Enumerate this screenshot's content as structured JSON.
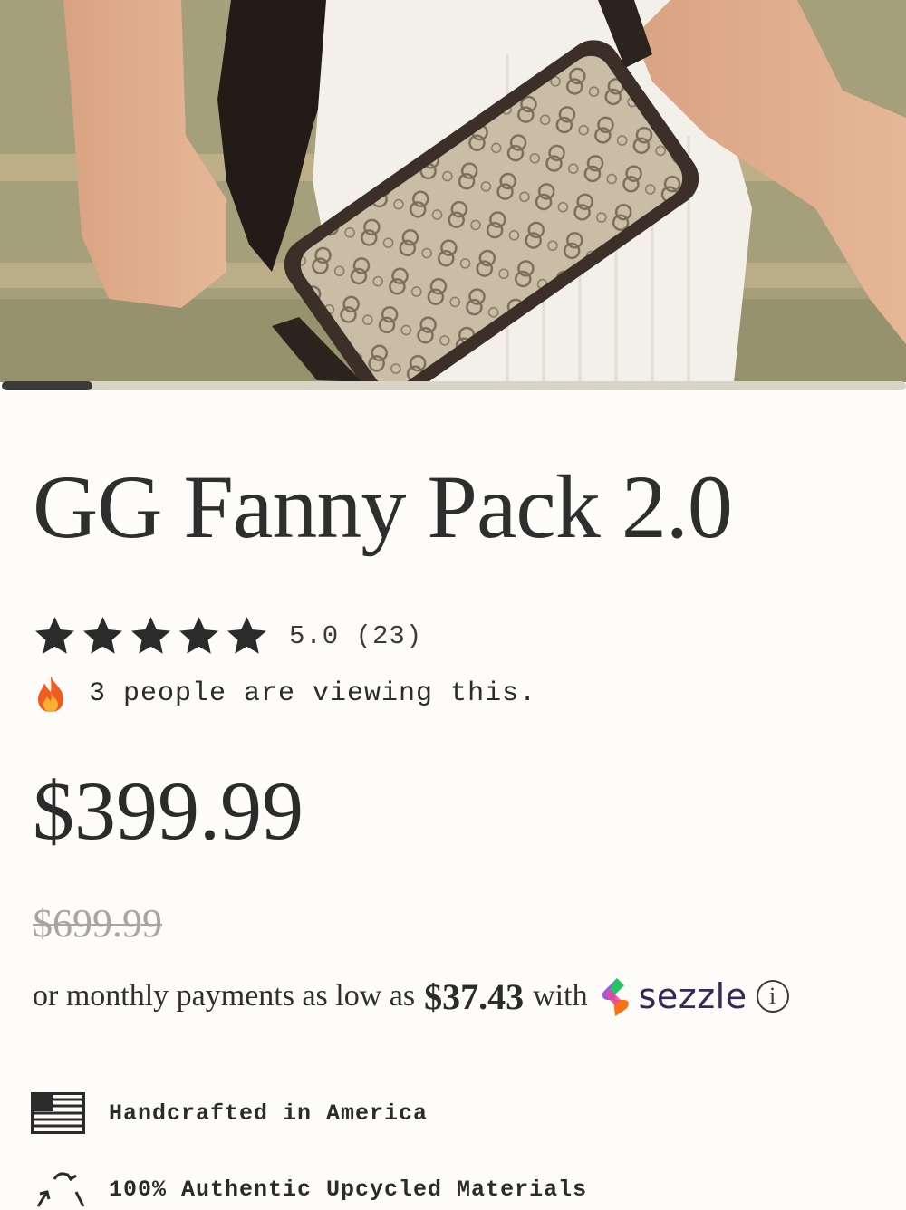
{
  "gallery": {
    "image_alt": "GG Fanny Pack 2.0",
    "progress": 0.1
  },
  "product": {
    "title": "GG Fanny Pack 2.0",
    "rating_text": "5.0 (23)",
    "rating_value": 5,
    "stars_max": 5,
    "viewers_text": "3 people are viewing this.",
    "price": "$399.99",
    "compare_at_price": "$699.99"
  },
  "installments": {
    "prefix": "or monthly payments as low as",
    "amount": "$37.43",
    "connector": "with",
    "provider": "sezzle",
    "info_icon": "info-icon"
  },
  "features": [
    {
      "icon": "us-flag-icon",
      "label": "Handcrafted in America"
    },
    {
      "icon": "recycle-icon",
      "label": "100% Authentic Upcycled Materials"
    }
  ],
  "colors": {
    "background": "#fdfcf8",
    "text": "#2b2b2b",
    "muted_price": "#a8a6a0",
    "sezzle_brand": "#382757"
  }
}
